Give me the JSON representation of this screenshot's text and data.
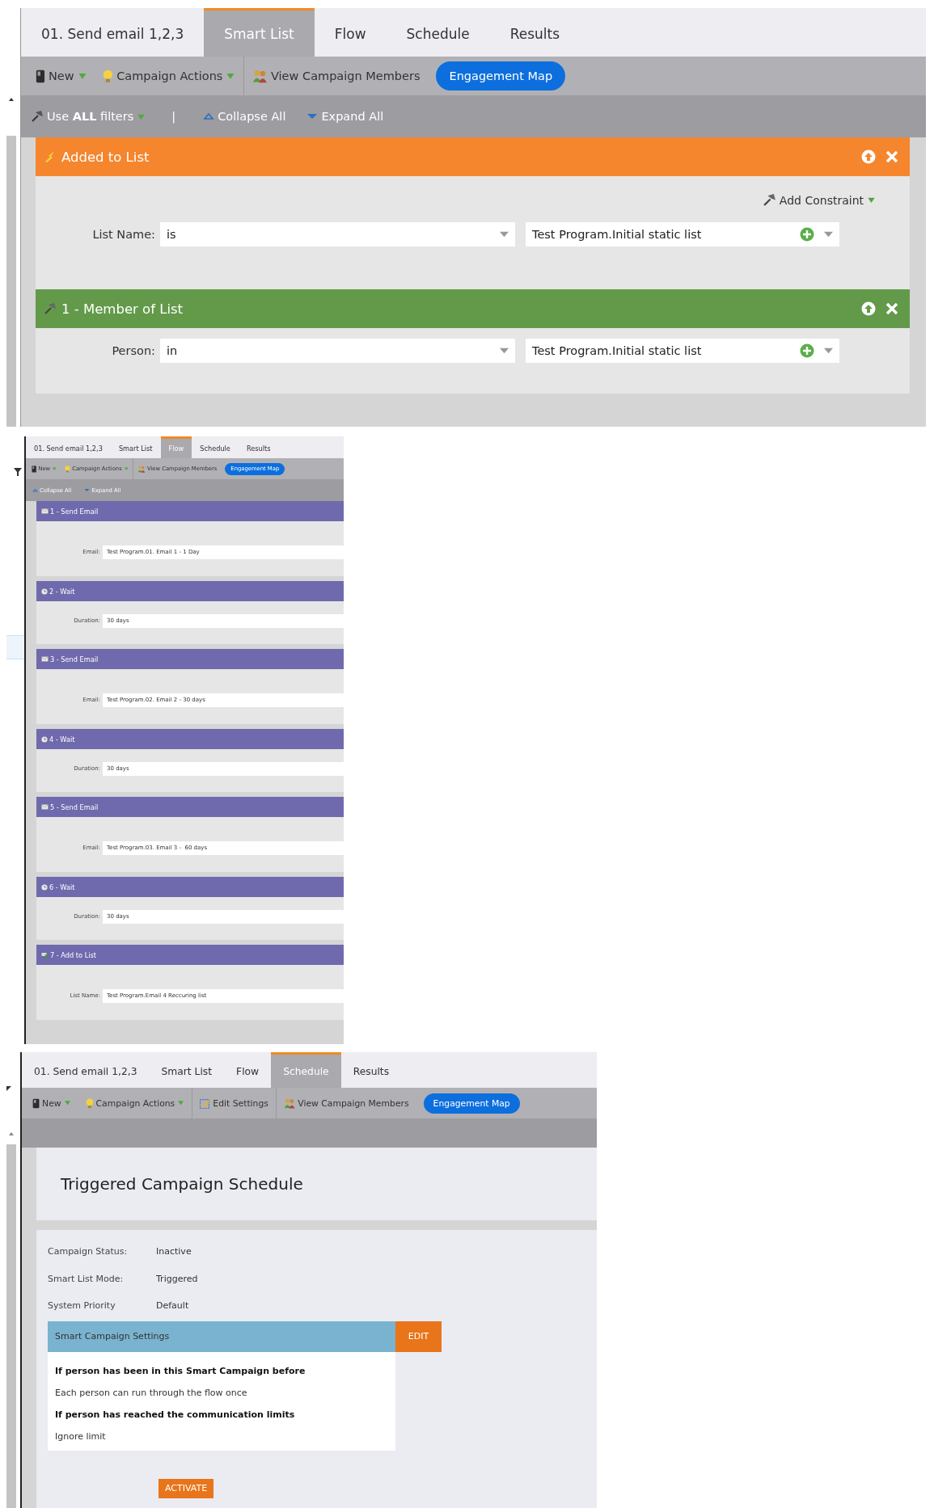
{
  "smart_list_view": {
    "tabs": [
      {
        "label": "01. Send email 1,2,3",
        "selected": false
      },
      {
        "label": "Smart List",
        "selected": true
      },
      {
        "label": "Flow",
        "selected": false
      },
      {
        "label": "Schedule",
        "selected": false
      },
      {
        "label": "Results",
        "selected": false
      }
    ],
    "toolbar": [
      {
        "kind": "new",
        "label": "New"
      },
      {
        "kind": "actions",
        "label": "Campaign Actions"
      },
      {
        "kind": "members",
        "label": "View Campaign Members"
      },
      {
        "kind": "map",
        "label": "Engagement Map"
      }
    ],
    "filter_bar": {
      "filter_logic": "Use **ALL** filters",
      "separator": "|",
      "collapse": "Collapse All",
      "expand": "Expand All"
    },
    "filters": [
      {
        "kind": "trigger",
        "title": "Added to List",
        "add_constraint": "Add Constraint",
        "rows": [
          {
            "label": "List Name:",
            "operator": "is",
            "value": "Test Program.Initial static list"
          }
        ]
      },
      {
        "kind": "filter",
        "title": "1 - Member of List",
        "rows": [
          {
            "label": "Person:",
            "operator": "in",
            "value": "Test Program.Initial static list"
          }
        ]
      }
    ]
  },
  "flow_view": {
    "tabs": [
      {
        "label": "01. Send email 1,2,3",
        "selected": false
      },
      {
        "label": "Smart List",
        "selected": false
      },
      {
        "label": "Flow",
        "selected": true
      },
      {
        "label": "Schedule",
        "selected": false
      },
      {
        "label": "Results",
        "selected": false
      }
    ],
    "toolbar": [
      {
        "kind": "new",
        "label": "New"
      },
      {
        "kind": "actions",
        "label": "Campaign Actions"
      },
      {
        "kind": "members",
        "label": "View Campaign Members"
      },
      {
        "kind": "map",
        "label": "Engagement Map"
      }
    ],
    "flow_bar": {
      "collapse": "Collapse All",
      "expand": "Expand All"
    },
    "steps": [
      {
        "kind": "email",
        "title": "1 - Send Email",
        "field_label": "Email:",
        "value": "Test Program.01. Email 1 - 1 Day"
      },
      {
        "kind": "wait",
        "title": "2 - Wait",
        "field_label": "Duration:",
        "value": "30 days"
      },
      {
        "kind": "email",
        "title": "3 - Send Email",
        "field_label": "Email:",
        "value": "Test Program.02. Email 2 - 30 days"
      },
      {
        "kind": "wait",
        "title": "4 - Wait",
        "field_label": "Duration:",
        "value": "30 days"
      },
      {
        "kind": "email",
        "title": "5 - Send Email",
        "field_label": "Email:",
        "value": "Test Program.03. Email 3 -  60 days"
      },
      {
        "kind": "wait",
        "title": "6 - Wait",
        "field_label": "Duration:",
        "value": "30 days"
      },
      {
        "kind": "list",
        "title": "7 - Add to List",
        "field_label": "List Name:",
        "value": "Test Program.Email 4 Reccuring list"
      }
    ]
  },
  "schedule_view": {
    "tabs": [
      {
        "label": "01. Send email 1,2,3",
        "selected": false
      },
      {
        "label": "Smart List",
        "selected": false
      },
      {
        "label": "Flow",
        "selected": false
      },
      {
        "label": "Schedule",
        "selected": true
      },
      {
        "label": "Results",
        "selected": false
      }
    ],
    "toolbar": [
      {
        "kind": "new",
        "label": "New"
      },
      {
        "kind": "actions",
        "label": "Campaign Actions"
      },
      {
        "kind": "edit",
        "label": "Edit Settings"
      },
      {
        "kind": "members",
        "label": "View Campaign Members"
      },
      {
        "kind": "map",
        "label": "Engagement Map"
      }
    ],
    "title": "Triggered Campaign Schedule",
    "details": [
      {
        "label": "Campaign Status:",
        "value": "Inactive"
      },
      {
        "label": "Smart List Mode:",
        "value": "Triggered"
      },
      {
        "label": "System Priority",
        "value": "Default"
      }
    ],
    "settings": {
      "title": "Smart Campaign Settings",
      "edit": "EDIT",
      "items": [
        {
          "kind": "heading",
          "text": "If person has been in this Smart Campaign before"
        },
        {
          "kind": "text",
          "text": "Each person can run through the flow once"
        },
        {
          "kind": "heading",
          "text": "If person has reached the communication limits"
        },
        {
          "kind": "text",
          "text": "Ignore limit"
        }
      ]
    },
    "activate": "ACTIVATE"
  }
}
